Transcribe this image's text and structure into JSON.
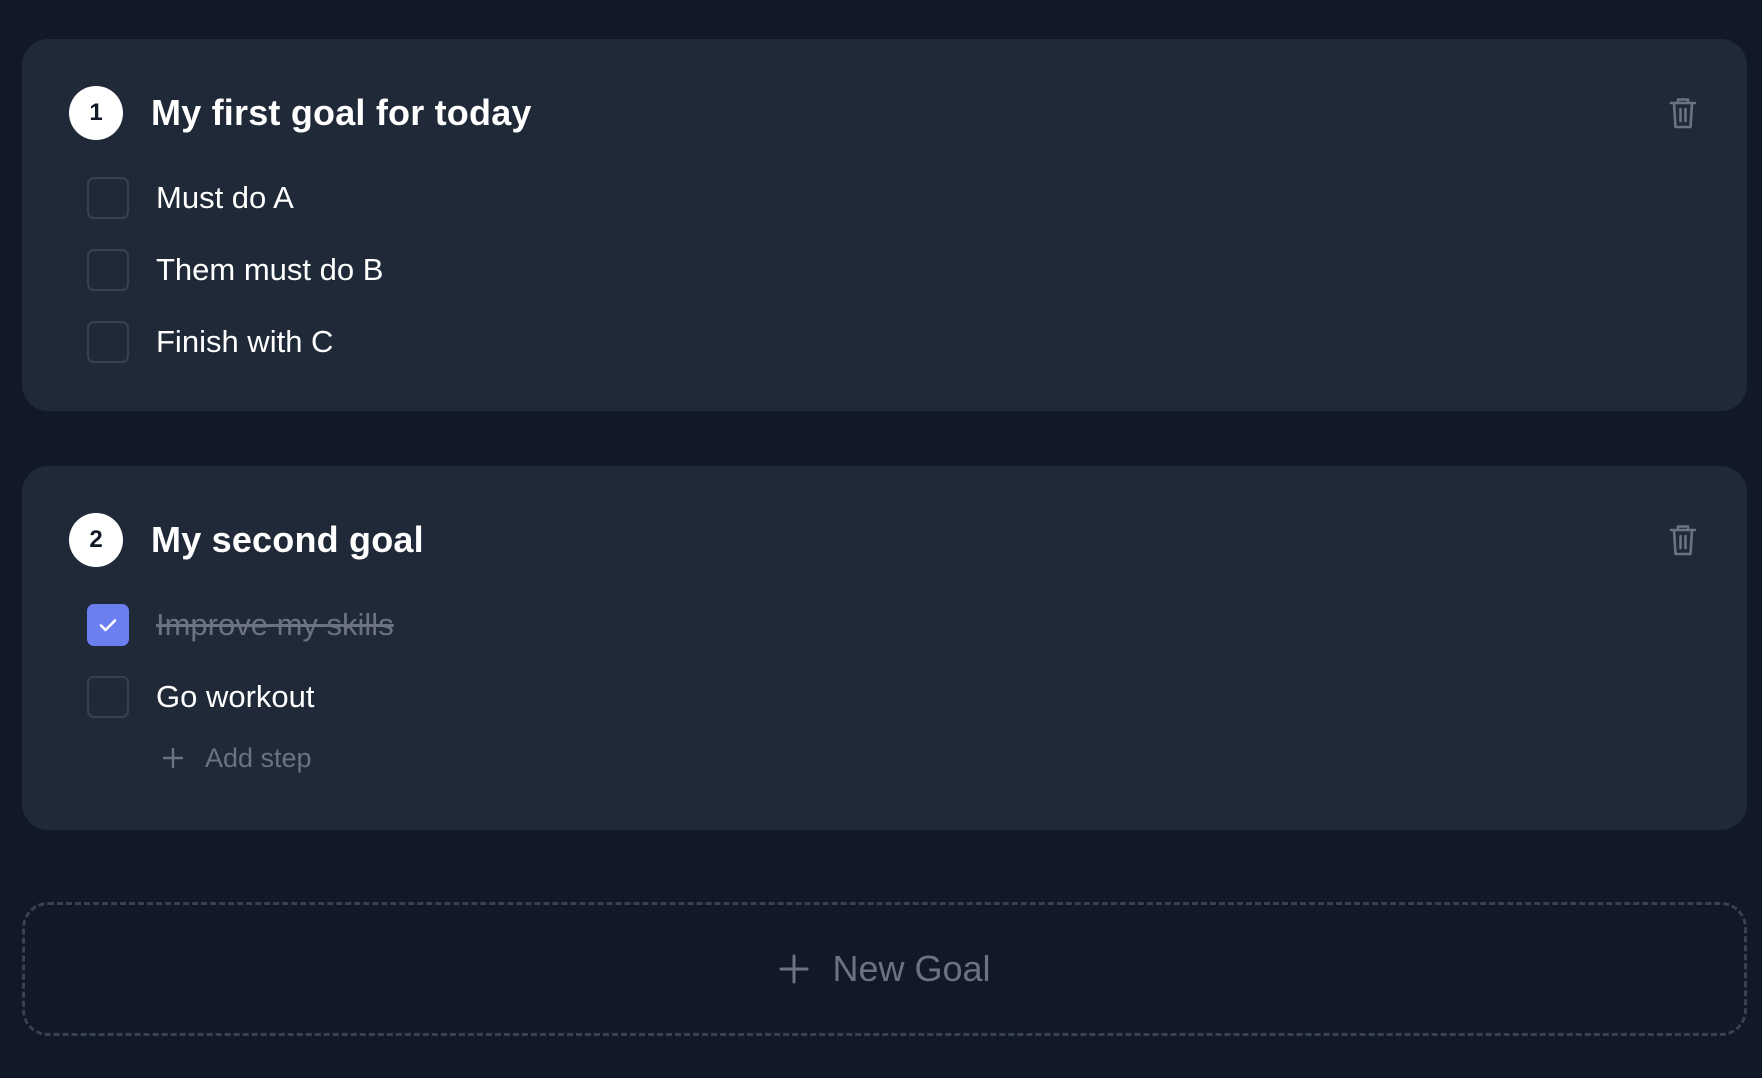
{
  "colors": {
    "page_background": "#111827",
    "card_background": "#1f2937",
    "checkbox_border": "#374151",
    "checked_accent": "#6b7ff0",
    "muted_text": "#6b7280",
    "title_text": "#ffffff"
  },
  "goals": [
    {
      "number": "1",
      "title": "My first goal for today",
      "delete_icon": "trash-icon",
      "steps": [
        {
          "label": "Must do A",
          "checked": false
        },
        {
          "label": "Them must do B",
          "checked": false
        },
        {
          "label": "Finish with C",
          "checked": false
        }
      ]
    },
    {
      "number": "2",
      "title": "My second goal",
      "delete_icon": "trash-icon",
      "steps": [
        {
          "label": "Improve my skills",
          "checked": true
        },
        {
          "label": "Go workout",
          "checked": false
        }
      ],
      "add_step_label": "Add step"
    }
  ],
  "new_goal": {
    "label": "New Goal",
    "icon": "plus-icon"
  }
}
